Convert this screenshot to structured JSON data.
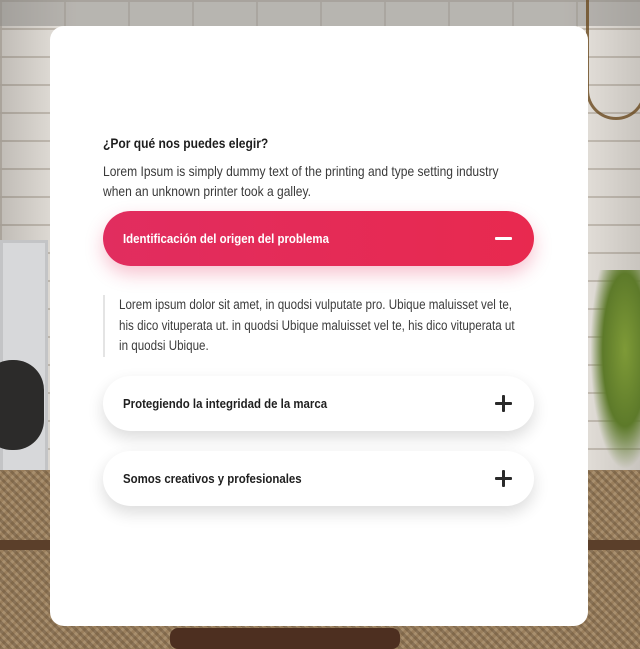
{
  "section": {
    "heading": "¿Por qué nos puedes elegir?",
    "intro": "Lorem Ipsum is simply dummy text of the printing and type setting industry when an unknown printer took a galley."
  },
  "accordion": {
    "items": [
      {
        "label": "Identificación del origen del problema",
        "expanded": true,
        "toggle_icon": "minus-icon",
        "content": "Lorem ipsum dolor sit amet, in quodsi vulputate pro. Ubique maluisset vel te, his dico vituperata ut. in quodsi Ubique maluisset vel te, his dico vituperata ut in quodsi Ubique."
      },
      {
        "label": "Protegiendo la integridad de la marca",
        "expanded": false,
        "toggle_icon": "plus-icon"
      },
      {
        "label": "Somos creativos y profesionales",
        "expanded": false,
        "toggle_icon": "plus-icon"
      }
    ]
  },
  "colors": {
    "accent": "#e12d5f",
    "card_background": "#ffffff",
    "text_dark": "#1e1e1e"
  }
}
